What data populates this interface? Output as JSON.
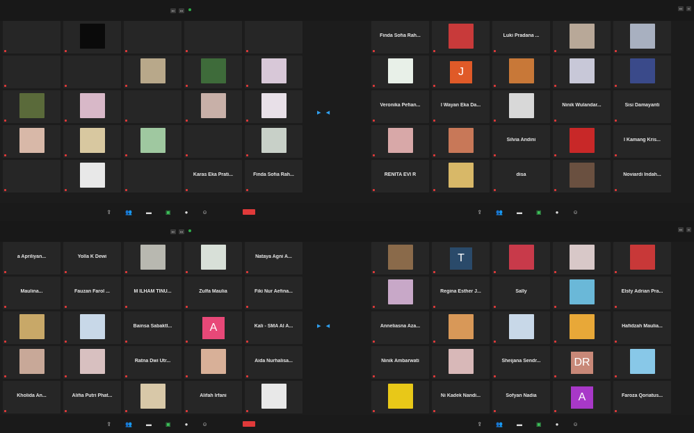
{
  "top_left": {
    "tiles": [
      {
        "label": "",
        "row": 0,
        "col": 0,
        "bg": "#262626"
      },
      {
        "label": "",
        "row": 0,
        "col": 1,
        "bg": "#0a0a0a"
      },
      {
        "label": "",
        "row": 0,
        "col": 2,
        "bg": "#262626"
      },
      {
        "label": "",
        "row": 0,
        "col": 3,
        "bg": "#262626"
      },
      {
        "label": "",
        "row": 0,
        "col": 4,
        "bg": "#262626"
      },
      {
        "label": "",
        "row": 1,
        "col": 0,
        "bg": "#262626"
      },
      {
        "label": "",
        "row": 1,
        "col": 1,
        "bg": "#262626"
      },
      {
        "label": "",
        "row": 1,
        "col": 2,
        "bg": "#b8a88a"
      },
      {
        "label": "",
        "row": 1,
        "col": 3,
        "bg": "#3e6b3a"
      },
      {
        "label": "",
        "row": 1,
        "col": 4,
        "bg": "#d8c8d8"
      },
      {
        "label": "",
        "row": 2,
        "col": 0,
        "bg": "#5a6a3a"
      },
      {
        "label": "",
        "row": 2,
        "col": 1,
        "bg": "#d8b8c8"
      },
      {
        "label": "",
        "row": 2,
        "col": 2,
        "bg": "#262626"
      },
      {
        "label": "",
        "row": 2,
        "col": 3,
        "bg": "#c8b0a8"
      },
      {
        "label": "",
        "row": 2,
        "col": 4,
        "bg": "#e8e0e8"
      },
      {
        "label": "",
        "row": 3,
        "col": 0,
        "bg": "#d8b8a8"
      },
      {
        "label": "",
        "row": 3,
        "col": 1,
        "bg": "#d8c8a0"
      },
      {
        "label": "",
        "row": 3,
        "col": 2,
        "bg": "#9fc8a0"
      },
      {
        "label": "",
        "row": 3,
        "col": 3,
        "bg": "#262626"
      },
      {
        "label": "",
        "row": 3,
        "col": 4,
        "bg": "#c8d0c8"
      },
      {
        "label": "",
        "row": 4,
        "col": 0,
        "bg": "#262626"
      },
      {
        "label": "",
        "row": 4,
        "col": 1,
        "bg": "#e8e8e8"
      },
      {
        "label": "",
        "row": 4,
        "col": 2,
        "bg": "#262626"
      },
      {
        "label": "Karas Eka Prati...",
        "row": 4,
        "col": 3,
        "bg": "#262626"
      },
      {
        "label": "Finda Sofia Rah...",
        "row": 4,
        "col": 4,
        "bg": "#262626"
      }
    ]
  },
  "top_right": {
    "tiles": [
      {
        "label": "Finda Sofia Rah...",
        "row": 0,
        "col": 0,
        "bg": "#262626"
      },
      {
        "label": "",
        "row": 0,
        "col": 1,
        "bg": "#c83a3a"
      },
      {
        "label": "Luki Pradana ...",
        "row": 0,
        "col": 2,
        "bg": "#262626"
      },
      {
        "label": "",
        "row": 0,
        "col": 3,
        "bg": "#b8a898"
      },
      {
        "label": "",
        "row": 0,
        "col": 4,
        "bg": "#a8b0c0"
      },
      {
        "label": "",
        "row": 1,
        "col": 0,
        "bg": "#e8f0e8"
      },
      {
        "label": "",
        "row": 1,
        "col": 1,
        "bg": "#e05a28",
        "letter": "J"
      },
      {
        "label": "",
        "row": 1,
        "col": 2,
        "bg": "#c87838"
      },
      {
        "label": "",
        "row": 1,
        "col": 3,
        "bg": "#c8c8d8"
      },
      {
        "label": "",
        "row": 1,
        "col": 4,
        "bg": "#3a4a8a"
      },
      {
        "label": "Veronika Pefian...",
        "row": 2,
        "col": 0,
        "bg": "#262626"
      },
      {
        "label": "I Wayan Eka Da...",
        "row": 2,
        "col": 1,
        "bg": "#262626"
      },
      {
        "label": "",
        "row": 2,
        "col": 2,
        "bg": "#d8d8d8"
      },
      {
        "label": "Ninik Wulandar...",
        "row": 2,
        "col": 3,
        "bg": "#262626"
      },
      {
        "label": "Sisi Damayanti",
        "row": 2,
        "col": 4,
        "bg": "#262626"
      },
      {
        "label": "",
        "row": 3,
        "col": 0,
        "bg": "#d8a8a8"
      },
      {
        "label": "",
        "row": 3,
        "col": 1,
        "bg": "#c87858"
      },
      {
        "label": "Silvia Andini",
        "row": 3,
        "col": 2,
        "bg": "#262626"
      },
      {
        "label": "",
        "row": 3,
        "col": 3,
        "bg": "#c82828"
      },
      {
        "label": "I Kamang Kris...",
        "row": 3,
        "col": 4,
        "bg": "#262626"
      },
      {
        "label": "RENITA EVI R",
        "row": 4,
        "col": 0,
        "bg": "#262626"
      },
      {
        "label": "",
        "row": 4,
        "col": 1,
        "bg": "#d8b868"
      },
      {
        "label": "disa",
        "row": 4,
        "col": 2,
        "bg": "#262626"
      },
      {
        "label": "",
        "row": 4,
        "col": 3,
        "bg": "#6a5040"
      },
      {
        "label": "Noviardi Indah...",
        "row": 4,
        "col": 4,
        "bg": "#262626"
      }
    ]
  },
  "bottom_left": {
    "tiles": [
      {
        "label": "a Apriliyan...",
        "row": 0,
        "col": 0,
        "bg": "#262626"
      },
      {
        "label": "Yolla K Dewi",
        "row": 0,
        "col": 1,
        "bg": "#262626"
      },
      {
        "label": "",
        "row": 0,
        "col": 2,
        "bg": "#b8b8b0"
      },
      {
        "label": "",
        "row": 0,
        "col": 3,
        "bg": "#d8e0d8"
      },
      {
        "label": "Nataya Agni A...",
        "row": 0,
        "col": 4,
        "bg": "#262626"
      },
      {
        "label": "Maulina...",
        "row": 1,
        "col": 0,
        "bg": "#262626"
      },
      {
        "label": "Fauzan Farol ...",
        "row": 1,
        "col": 1,
        "bg": "#262626"
      },
      {
        "label": "M ILHAM TINU...",
        "row": 1,
        "col": 2,
        "bg": "#262626"
      },
      {
        "label": "Zulfa Maulia",
        "row": 1,
        "col": 3,
        "bg": "#262626"
      },
      {
        "label": "Fiki Nur Aefina...",
        "row": 1,
        "col": 4,
        "bg": "#262626"
      },
      {
        "label": "",
        "row": 2,
        "col": 0,
        "bg": "#c8a868"
      },
      {
        "label": "",
        "row": 2,
        "col": 1,
        "bg": "#c8d8e8"
      },
      {
        "label": "Bainsa Sabaktl...",
        "row": 2,
        "col": 2,
        "bg": "#262626"
      },
      {
        "label": "",
        "row": 2,
        "col": 3,
        "bg": "#e84878",
        "letter": "A"
      },
      {
        "label": "Kali - SMA Al A...",
        "row": 2,
        "col": 4,
        "bg": "#262626"
      },
      {
        "label": "",
        "row": 3,
        "col": 0,
        "bg": "#c8a898"
      },
      {
        "label": "",
        "row": 3,
        "col": 1,
        "bg": "#d8c0c0"
      },
      {
        "label": "Ratna Dwi Utr...",
        "row": 3,
        "col": 2,
        "bg": "#262626"
      },
      {
        "label": "",
        "row": 3,
        "col": 3,
        "bg": "#d8b098"
      },
      {
        "label": "Aida Nurhalisa...",
        "row": 3,
        "col": 4,
        "bg": "#262626"
      },
      {
        "label": "Kholida An...",
        "row": 4,
        "col": 0,
        "bg": "#262626"
      },
      {
        "label": "Alifia Putri Phat...",
        "row": 4,
        "col": 1,
        "bg": "#262626"
      },
      {
        "label": "",
        "row": 4,
        "col": 2,
        "bg": "#d8c8a8"
      },
      {
        "label": "Alifah Irfani",
        "row": 4,
        "col": 3,
        "bg": "#262626"
      },
      {
        "label": "",
        "row": 4,
        "col": 4,
        "bg": "#e8e8e8"
      }
    ]
  },
  "bottom_right": {
    "tiles": [
      {
        "label": "",
        "row": 0,
        "col": 0,
        "bg": "#8a6a4a"
      },
      {
        "label": "",
        "row": 0,
        "col": 1,
        "bg": "#2a4a6a",
        "letter": "T"
      },
      {
        "label": "",
        "row": 0,
        "col": 2,
        "bg": "#c83a4a"
      },
      {
        "label": "",
        "row": 0,
        "col": 3,
        "bg": "#d8c8c8"
      },
      {
        "label": "",
        "row": 0,
        "col": 4,
        "bg": "#c83838"
      },
      {
        "label": "",
        "row": 1,
        "col": 0,
        "bg": "#c8a8c8"
      },
      {
        "label": "Regina Esther J...",
        "row": 1,
        "col": 1,
        "bg": "#262626"
      },
      {
        "label": "Sally",
        "row": 1,
        "col": 2,
        "bg": "#262626"
      },
      {
        "label": "",
        "row": 1,
        "col": 3,
        "bg": "#6ab8d8"
      },
      {
        "label": "Elsty Adrian Pra...",
        "row": 1,
        "col": 4,
        "bg": "#262626"
      },
      {
        "label": "Anneliasna Aza...",
        "row": 2,
        "col": 0,
        "bg": "#262626"
      },
      {
        "label": "",
        "row": 2,
        "col": 1,
        "bg": "#d89858"
      },
      {
        "label": "",
        "row": 2,
        "col": 2,
        "bg": "#c8d8e8"
      },
      {
        "label": "",
        "row": 2,
        "col": 3,
        "bg": "#e8a838"
      },
      {
        "label": "Hafidzah Maulia...",
        "row": 2,
        "col": 4,
        "bg": "#262626"
      },
      {
        "label": "Ninik Ambarwati",
        "row": 3,
        "col": 0,
        "bg": "#262626"
      },
      {
        "label": "",
        "row": 3,
        "col": 1,
        "bg": "#d8b8b8"
      },
      {
        "label": "Sheijana Sendr...",
        "row": 3,
        "col": 2,
        "bg": "#262626"
      },
      {
        "label": "",
        "row": 3,
        "col": 3,
        "bg": "#c88878",
        "letter": "DR"
      },
      {
        "label": "",
        "row": 3,
        "col": 4,
        "bg": "#88c8e8"
      },
      {
        "label": "",
        "row": 4,
        "col": 0,
        "bg": "#e8c818"
      },
      {
        "label": "Ni Kadek Nandi...",
        "row": 4,
        "col": 1,
        "bg": "#262626"
      },
      {
        "label": "Sofyan Nadia",
        "row": 4,
        "col": 2,
        "bg": "#262626"
      },
      {
        "label": "",
        "row": 4,
        "col": 3,
        "bg": "#a838c8",
        "letter": "A"
      },
      {
        "label": "Faroza Qoriatus...",
        "row": 4,
        "col": 4,
        "bg": "#262626"
      }
    ]
  },
  "toolbar_tools": [
    {
      "icon": "share-icon",
      "glyph": "⇪"
    },
    {
      "icon": "participants-icon",
      "glyph": "👥"
    },
    {
      "icon": "chat-icon",
      "glyph": "▬"
    },
    {
      "icon": "share-screen-icon",
      "glyph": "▣",
      "green": true
    },
    {
      "icon": "record-icon",
      "glyph": "●"
    },
    {
      "icon": "reactions-icon",
      "glyph": "☺"
    }
  ],
  "end_button_color": "#e03a3a",
  "nav_arrows": "▸ ◂"
}
